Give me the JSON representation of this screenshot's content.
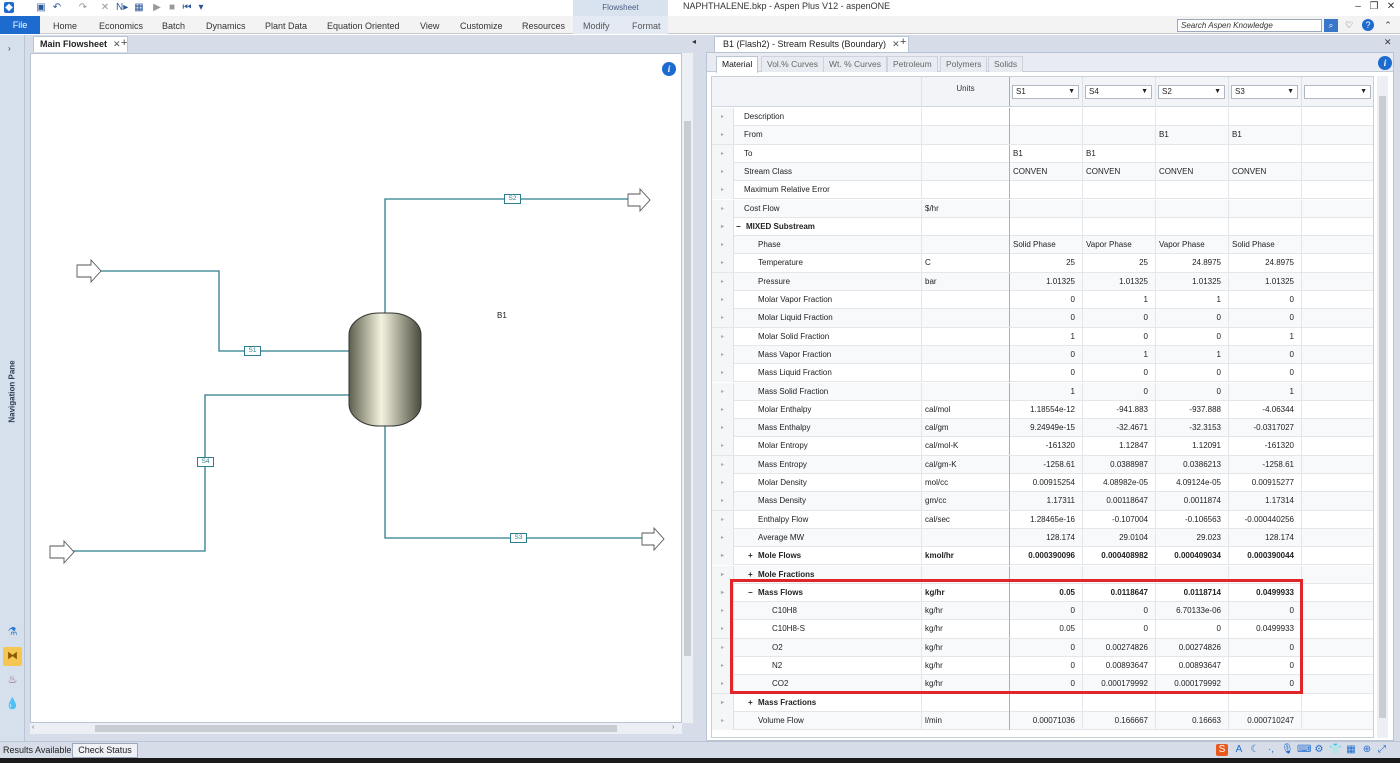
{
  "title_bar": {
    "title": "NAPHTHALENE.bkp - Aspen Plus V12 - aspenONE",
    "context_group": "Flowsheet",
    "controls": [
      "minimize",
      "restore",
      "close"
    ]
  },
  "ribbon": {
    "file_label": "File",
    "tabs": [
      "Home",
      "Economics",
      "Batch",
      "Dynamics",
      "Plant Data",
      "Equation Oriented",
      "View",
      "Customize",
      "Resources"
    ],
    "context_tabs": [
      "Modify",
      "Format"
    ],
    "search_placeholder": "Search Aspen Knowledge"
  },
  "nav_pane": {
    "label": "Navigation Pane"
  },
  "flowsheet": {
    "tab_label": "Main Flowsheet",
    "block_label": "B1",
    "streams": [
      "S1",
      "S2",
      "S3",
      "S4"
    ]
  },
  "results": {
    "tab_label": "B1 (Flash2) - Stream Results (Boundary)",
    "subtabs": [
      "Material",
      "Vol.% Curves",
      "Wt. % Curves",
      "Petroleum",
      "Polymers",
      "Solids"
    ],
    "units_header": "Units",
    "columns": [
      "S1",
      "S4",
      "S2",
      "S3",
      ""
    ],
    "rows": [
      {
        "name": "Description",
        "unit": "",
        "values": [
          "",
          "",
          "",
          ""
        ],
        "indent": 0
      },
      {
        "name": "From",
        "unit": "",
        "values": [
          "",
          "",
          "B1",
          "B1"
        ],
        "indent": 0,
        "text": true
      },
      {
        "name": "To",
        "unit": "",
        "values": [
          "B1",
          "B1",
          "",
          ""
        ],
        "indent": 0,
        "text": true
      },
      {
        "name": "Stream Class",
        "unit": "",
        "values": [
          "CONVEN",
          "CONVEN",
          "CONVEN",
          "CONVEN"
        ],
        "indent": 0,
        "text": true
      },
      {
        "name": "Maximum Relative Error",
        "unit": "",
        "values": [
          "",
          "",
          "",
          ""
        ],
        "indent": 0
      },
      {
        "name": "Cost Flow",
        "unit": "$/hr",
        "values": [
          "",
          "",
          "",
          ""
        ],
        "indent": 0
      },
      {
        "name": "MIXED Substream",
        "unit": "",
        "values": [
          "",
          "",
          "",
          ""
        ],
        "indent": 0,
        "bold": true,
        "exp": "−"
      },
      {
        "name": "Phase",
        "unit": "",
        "values": [
          "Solid Phase",
          "Vapor Phase",
          "Vapor Phase",
          "Solid Phase"
        ],
        "indent": 1,
        "text": true
      },
      {
        "name": "Temperature",
        "unit": "C",
        "values": [
          "25",
          "25",
          "24.8975",
          "24.8975"
        ],
        "indent": 1
      },
      {
        "name": "Pressure",
        "unit": "bar",
        "values": [
          "1.01325",
          "1.01325",
          "1.01325",
          "1.01325"
        ],
        "indent": 1
      },
      {
        "name": "Molar Vapor Fraction",
        "unit": "",
        "values": [
          "0",
          "1",
          "1",
          "0"
        ],
        "indent": 1
      },
      {
        "name": "Molar Liquid Fraction",
        "unit": "",
        "values": [
          "0",
          "0",
          "0",
          "0"
        ],
        "indent": 1
      },
      {
        "name": "Molar Solid Fraction",
        "unit": "",
        "values": [
          "1",
          "0",
          "0",
          "1"
        ],
        "indent": 1
      },
      {
        "name": "Mass Vapor Fraction",
        "unit": "",
        "values": [
          "0",
          "1",
          "1",
          "0"
        ],
        "indent": 1
      },
      {
        "name": "Mass Liquid Fraction",
        "unit": "",
        "values": [
          "0",
          "0",
          "0",
          "0"
        ],
        "indent": 1
      },
      {
        "name": "Mass Solid Fraction",
        "unit": "",
        "values": [
          "1",
          "0",
          "0",
          "1"
        ],
        "indent": 1
      },
      {
        "name": "Molar Enthalpy",
        "unit": "cal/mol",
        "values": [
          "1.18554e-12",
          "-941.883",
          "-937.888",
          "-4.06344"
        ],
        "indent": 1
      },
      {
        "name": "Mass Enthalpy",
        "unit": "cal/gm",
        "values": [
          "9.24949e-15",
          "-32.4671",
          "-32.3153",
          "-0.0317027"
        ],
        "indent": 1
      },
      {
        "name": "Molar Entropy",
        "unit": "cal/mol-K",
        "values": [
          "-161320",
          "1.12847",
          "1.12091",
          "-161320"
        ],
        "indent": 1
      },
      {
        "name": "Mass Entropy",
        "unit": "cal/gm-K",
        "values": [
          "-1258.61",
          "0.0388987",
          "0.0386213",
          "-1258.61"
        ],
        "indent": 1
      },
      {
        "name": "Molar Density",
        "unit": "mol/cc",
        "values": [
          "0.00915254",
          "4.08982e-05",
          "4.09124e-05",
          "0.00915277"
        ],
        "indent": 1
      },
      {
        "name": "Mass Density",
        "unit": "gm/cc",
        "values": [
          "1.17311",
          "0.00118647",
          "0.0011874",
          "1.17314"
        ],
        "indent": 1
      },
      {
        "name": "Enthalpy Flow",
        "unit": "cal/sec",
        "values": [
          "1.28465e-16",
          "-0.107004",
          "-0.106563",
          "-0.000440256"
        ],
        "indent": 1
      },
      {
        "name": "Average MW",
        "unit": "",
        "values": [
          "128.174",
          "29.0104",
          "29.023",
          "128.174"
        ],
        "indent": 1
      },
      {
        "name": "Mole Flows",
        "unit": "kmol/hr",
        "values": [
          "0.000390096",
          "0.000408982",
          "0.000409034",
          "0.000390044"
        ],
        "indent": 1,
        "bold": true,
        "exp": "+"
      },
      {
        "name": "Mole Fractions",
        "unit": "",
        "values": [
          "",
          "",
          "",
          ""
        ],
        "indent": 1,
        "bold": true,
        "exp": "+"
      },
      {
        "name": "Mass Flows",
        "unit": "kg/hr",
        "values": [
          "0.05",
          "0.0118647",
          "0.0118714",
          "0.0499933"
        ],
        "indent": 1,
        "bold": true,
        "exp": "−"
      },
      {
        "name": "C10H8",
        "unit": "kg/hr",
        "values": [
          "0",
          "0",
          "6.70133e-06",
          "0"
        ],
        "indent": 2
      },
      {
        "name": "C10H8-S",
        "unit": "kg/hr",
        "values": [
          "0.05",
          "0",
          "0",
          "0.0499933"
        ],
        "indent": 2
      },
      {
        "name": "O2",
        "unit": "kg/hr",
        "values": [
          "0",
          "0.00274826",
          "0.00274826",
          "0"
        ],
        "indent": 2
      },
      {
        "name": "N2",
        "unit": "kg/hr",
        "values": [
          "0",
          "0.00893647",
          "0.00893647",
          "0"
        ],
        "indent": 2
      },
      {
        "name": "CO2",
        "unit": "kg/hr",
        "values": [
          "0",
          "0.000179992",
          "0.000179992",
          "0"
        ],
        "indent": 2
      },
      {
        "name": "Mass Fractions",
        "unit": "",
        "values": [
          "",
          "",
          "",
          ""
        ],
        "indent": 1,
        "bold": true,
        "exp": "+"
      },
      {
        "name": "Volume Flow",
        "unit": "l/min",
        "values": [
          "0.00071036",
          "0.166667",
          "0.16663",
          "0.000710247"
        ],
        "indent": 1
      }
    ]
  },
  "status_bar": {
    "status": "Results Available",
    "check_button": "Check Status"
  },
  "colors": {
    "file_tab": "#1e6bd0",
    "stream_line": "#2e7d8c",
    "highlight": "#e0262b"
  }
}
